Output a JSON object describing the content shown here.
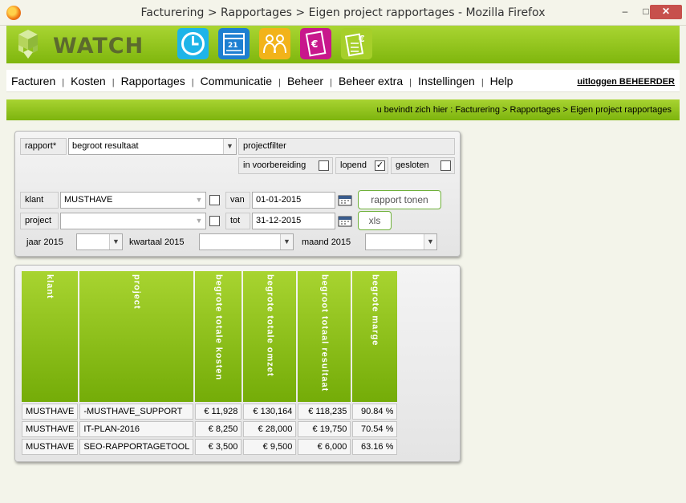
{
  "window": {
    "title": "Facturering > Rapportages > Eigen project rapportages - Mozilla Firefox",
    "minimize": "–",
    "maximize": "□",
    "close": "✕"
  },
  "app": {
    "logo_text": "WATCH",
    "icons": [
      "clock-icon",
      "calendar-icon",
      "people-icon",
      "invoice-euro-icon",
      "calculator-euro-icon"
    ]
  },
  "menu": {
    "items": [
      "Facturen",
      "Kosten",
      "Rapportages",
      "Communicatie",
      "Beheer",
      "Beheer extra",
      "Instellingen",
      "Help"
    ],
    "separator": "|",
    "logout": "uitloggen BEHEERDER"
  },
  "breadcrumb": "u bevindt zich hier : Facturering > Rapportages > Eigen project rapportages",
  "filters": {
    "rapport_label": "rapport*",
    "rapport_value": "begroot resultaat",
    "projectfilter_label": "projectfilter",
    "status": [
      {
        "label": "in voorbereiding",
        "checked": false
      },
      {
        "label": "lopend",
        "checked": true
      },
      {
        "label": "gesloten",
        "checked": false
      }
    ],
    "klant_label": "klant",
    "klant_value": "MUSTHAVE",
    "project_label": "project",
    "project_value": "",
    "van_label": "van",
    "van_value": "01-01-2015",
    "tot_label": "tot",
    "tot_value": "31-12-2015",
    "rapport_button": "rapport tonen",
    "xls_button": "xls",
    "jaar_label": "jaar 2015",
    "kwartaal_label": "kwartaal 2015",
    "maand_label": "maand 2015"
  },
  "results": {
    "headers": [
      "klant",
      "project",
      "begrote totale kosten",
      "begrote totale omzet",
      "begroot totaal resultaat",
      "begrote marge"
    ],
    "rows": [
      [
        "MUSTHAVE",
        "-MUSTHAVE_SUPPORT",
        "€ 11,928",
        "€ 130,164",
        "€ 118,235",
        "90.84 %"
      ],
      [
        "MUSTHAVE",
        "IT-PLAN-2016",
        "€ 8,250",
        "€ 28,000",
        "€ 19,750",
        "70.54 %"
      ],
      [
        "MUSTHAVE",
        "SEO-RAPPORTAGETOOL",
        "€ 3,500",
        "€ 9,500",
        "€ 6,000",
        "63.16 %"
      ]
    ]
  }
}
